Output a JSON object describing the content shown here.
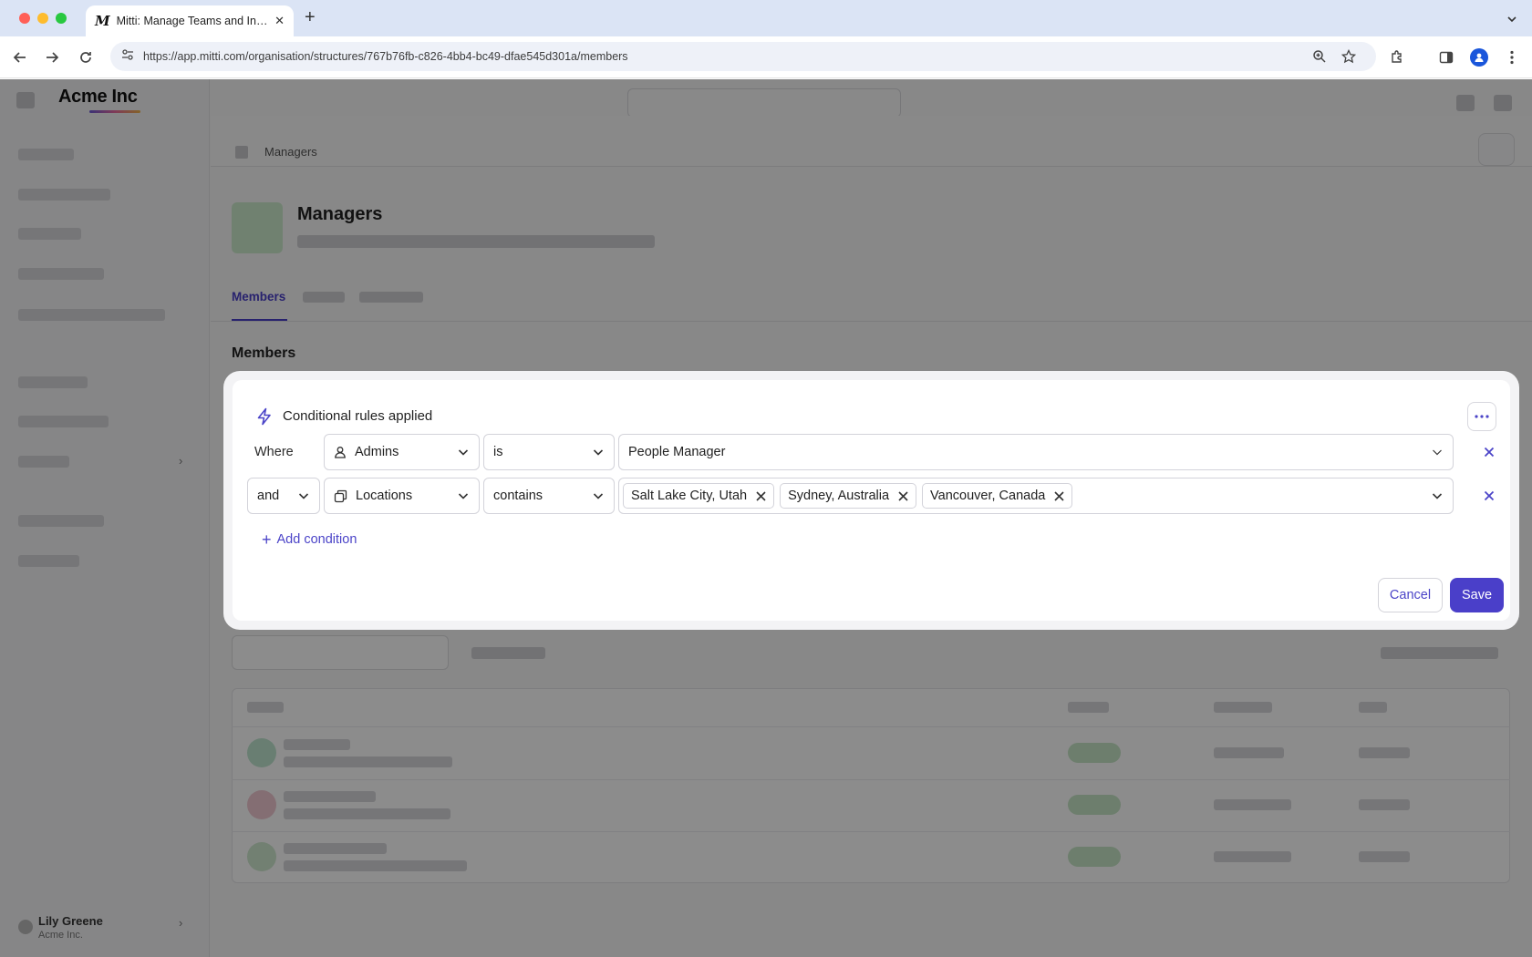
{
  "browser": {
    "tab_title": "Mitti: Manage Teams and Inspect...",
    "tab_favicon": "M",
    "url": "https://app.mitti.com/organisation/structures/767b76fb-c826-4bb4-bc49-dfae545d301a/members"
  },
  "app": {
    "brand": "Acme Inc",
    "breadcrumb": "Managers",
    "team_title": "Managers",
    "tab_members": "Members",
    "section_title": "Members",
    "user": {
      "name": "Lily Greene",
      "org": "Acme Inc."
    }
  },
  "modal": {
    "title": "Conditional rules applied",
    "rules": [
      {
        "connector": "Where",
        "field": "Admins",
        "field_icon": "user-icon",
        "operator": "is",
        "value": "People Manager"
      },
      {
        "connector": "and",
        "field": "Locations",
        "field_icon": "locations-icon",
        "operator": "contains",
        "chips": [
          "Salt Lake City, Utah",
          "Sydney, Australia",
          "Vancouver, Canada"
        ]
      }
    ],
    "add_condition": "Add condition",
    "cancel": "Cancel",
    "save": "Save"
  },
  "colors": {
    "accent": "#4a3fc9"
  }
}
